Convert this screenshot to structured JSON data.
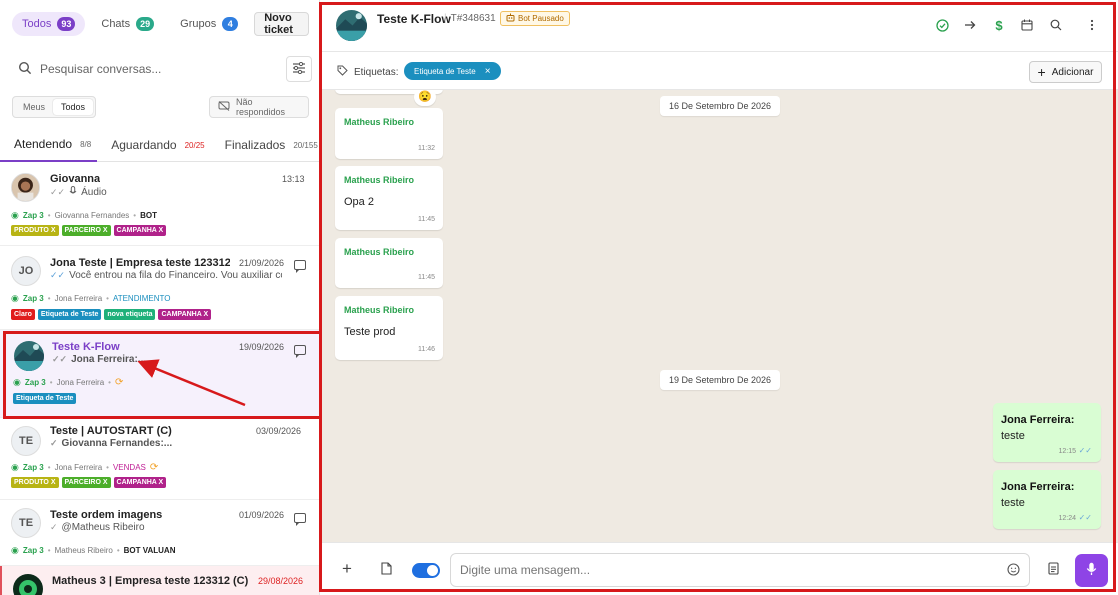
{
  "left": {
    "filters": [
      {
        "label": "Todos",
        "count": "93",
        "color": "#7b3fc7",
        "active": true
      },
      {
        "label": "Chats",
        "count": "29",
        "color": "#2aa98a",
        "active": false
      },
      {
        "label": "Grupos",
        "count": "4",
        "color": "#2f7ee0",
        "active": false
      }
    ],
    "new_ticket": "Novo ticket",
    "search_placeholder": "Pesquisar conversas...",
    "toggle": {
      "meus": "Meus",
      "todos": "Todos"
    },
    "unanswered": "Não respondidos",
    "tabs": [
      {
        "label": "Atendendo",
        "count": "8/8"
      },
      {
        "label": "Aguardando",
        "count": "20/25"
      },
      {
        "label": "Finalizados",
        "count": "20/155"
      }
    ],
    "conversations": [
      {
        "name": "Giovanna",
        "time": "13:13",
        "preview": "Áudio",
        "zap": "Zap 3",
        "agent": "Giovanna Fernandes",
        "status": "BOT",
        "tags": [
          {
            "label": "PRODUTO X",
            "color": "#b8b414"
          },
          {
            "label": "PARCEIRO X",
            "color": "#4cae2a"
          },
          {
            "label": "CAMPANHA X",
            "color": "#b0228a"
          }
        ]
      },
      {
        "initials": "JO",
        "name": "Jona Teste | Empresa teste 123312 (C)",
        "time": "21/09/2026",
        "preview": "Você entrou na fila do Financeiro. Vou auxiliar com p...",
        "zap": "Zap 3",
        "agent": "Jona Ferreira",
        "status": "ATENDIMENTO",
        "tags": [
          {
            "label": "Claro",
            "color": "#e01d1d"
          },
          {
            "label": "Etiqueta de Teste",
            "color": "#1b8fbf"
          },
          {
            "label": "nova etiqueta",
            "color": "#1fb07a"
          },
          {
            "label": "CAMPANHA X",
            "color": "#b0228a"
          }
        ]
      },
      {
        "name": "Teste K-Flow",
        "time": "19/09/2026",
        "preview": "Jona Ferreira:...",
        "zap": "Zap 3",
        "agent": "Jona Ferreira",
        "tags": [
          {
            "label": "Etiqueta de Teste",
            "color": "#1b8fbf"
          }
        ]
      },
      {
        "initials": "TE",
        "name": "Teste | AUTOSTART (C)",
        "time": "03/09/2026",
        "preview": "Giovanna Fernandes:...",
        "zap": "Zap 3",
        "agent": "Jona Ferreira",
        "status": "VENDAS",
        "tags": [
          {
            "label": "PRODUTO X",
            "color": "#b8b414"
          },
          {
            "label": "PARCEIRO X",
            "color": "#4cae2a"
          },
          {
            "label": "CAMPANHA X",
            "color": "#b0228a"
          }
        ]
      },
      {
        "initials": "TE",
        "name": "Teste ordem imagens",
        "time": "01/09/2026",
        "preview": "@Matheus Ribeiro",
        "zap": "Zap 3",
        "agent": "Matheus Ribeiro",
        "status": "BOT VALUAN"
      },
      {
        "name": "Matheus 3 | Empresa teste 123312 (C)",
        "time": "29/08/2026"
      }
    ]
  },
  "chat": {
    "title": "Teste K-Flow",
    "ticket": "T#348631",
    "bot_badge": "Bot Pausado",
    "labels_title": "Etiquetas:",
    "label_tag": "Etiqueta de Teste",
    "add_label": "Adicionar",
    "emoji": "😧",
    "dates": [
      "16 De Setembro De 2026",
      "19 De Setembro De 2026"
    ],
    "incoming": [
      {
        "sender": "Matheus Ribeiro",
        "text": "",
        "time": "11:32"
      },
      {
        "sender": "Matheus Ribeiro",
        "text": "Opa 2",
        "time": "11:45"
      },
      {
        "sender": "Matheus Ribeiro",
        "text": "",
        "time": "11:45"
      },
      {
        "sender": "Matheus Ribeiro",
        "text": "Teste prod",
        "time": "11:46"
      }
    ],
    "outgoing": [
      {
        "sender": "Jona Ferreira:",
        "text": "teste",
        "time": "12:15"
      },
      {
        "sender": "Jona Ferreira:",
        "text": "teste",
        "time": "12:24"
      }
    ],
    "composer_placeholder": "Digite uma mensagem..."
  },
  "colors": {
    "accent": "#7b3fc7",
    "annotation": "#d7191b",
    "whatsapp_green": "#2aa14e",
    "chat_bg": "#efeae2"
  },
  "icons": [
    "search-icon",
    "sliders-icon",
    "message-off-icon",
    "chat-bubble-icon",
    "whatsapp-icon",
    "mic-icon",
    "check-circle-icon",
    "arrow-right-icon",
    "dollar-icon",
    "calendar-icon",
    "kebab-icon",
    "tag-icon",
    "plus-icon",
    "attach-icon",
    "emoji-icon",
    "document-icon",
    "robot-icon",
    "sync-icon",
    "double-check-icon"
  ]
}
